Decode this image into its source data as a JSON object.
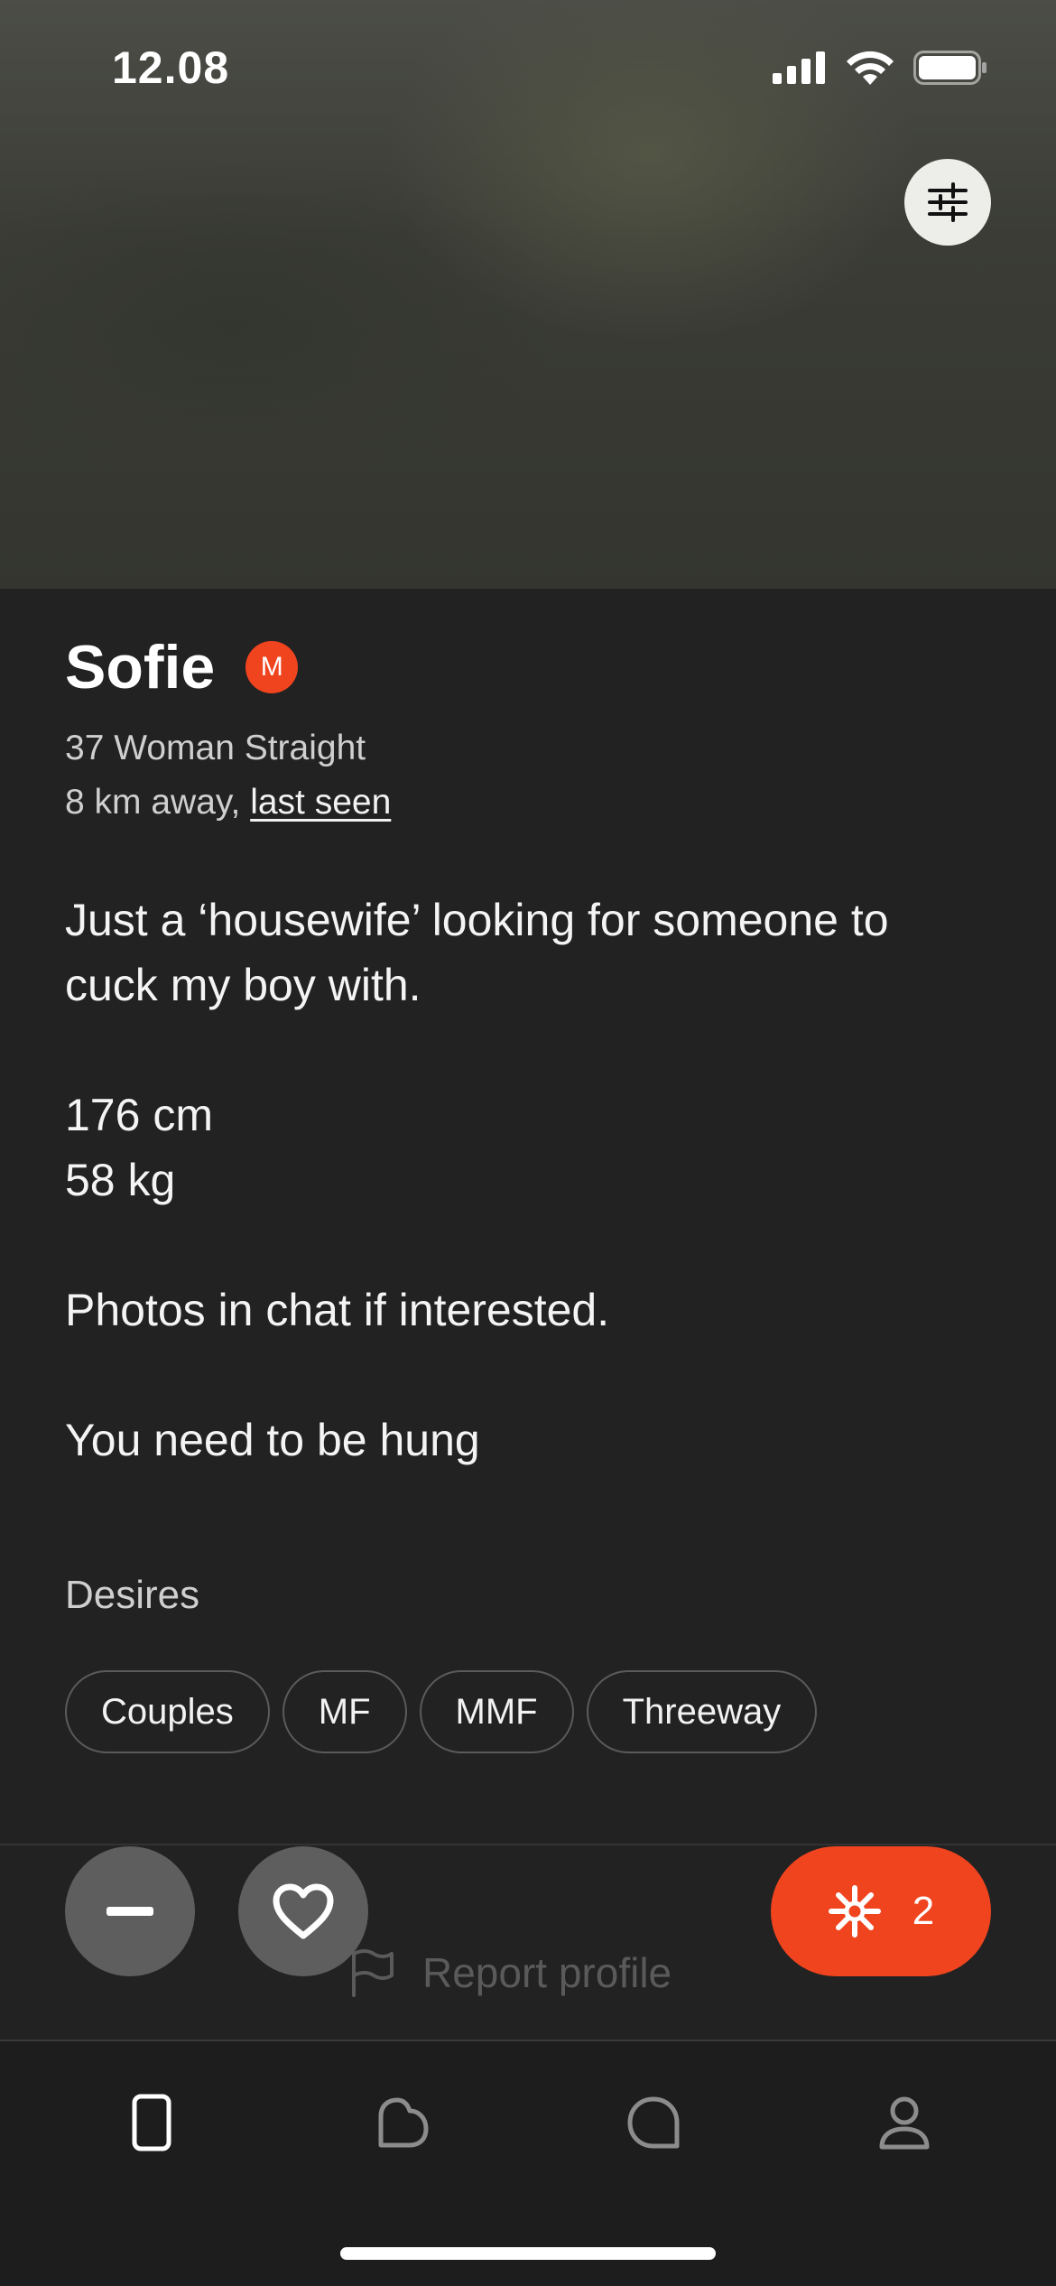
{
  "status_bar": {
    "time": "12.08",
    "icons": [
      "cellular-signal-icon",
      "wifi-icon",
      "battery-icon"
    ]
  },
  "photo": {
    "filter_icon": "sliders-icon"
  },
  "profile": {
    "name": "Sofie",
    "badge": "M",
    "demographics": "37 Woman Straight",
    "distance": "8 km away,",
    "last_seen_link": "last seen",
    "bio": [
      "Just a ‘housewife’ looking for someone to cuck my boy with.",
      "176 cm",
      "58 kg",
      "Photos in chat if interested.",
      "You need to be hung"
    ],
    "desires_title": "Desires",
    "desires": [
      "Couples",
      "MF",
      "MMF",
      "Threeway"
    ]
  },
  "actions": {
    "pass_icon": "minus-icon",
    "like_icon": "heart-icon",
    "spark_icon": "sparkle-icon",
    "spark_count": "2",
    "report_label": "Report profile",
    "report_icon": "flag-icon"
  },
  "tabbar": {
    "items": [
      "phone-card-icon",
      "dating-icon",
      "chat-bubble-icon",
      "profile-icon"
    ]
  },
  "colors": {
    "accent": "#f0441f",
    "background": "#222222",
    "button_gray": "#5e5e5e"
  }
}
